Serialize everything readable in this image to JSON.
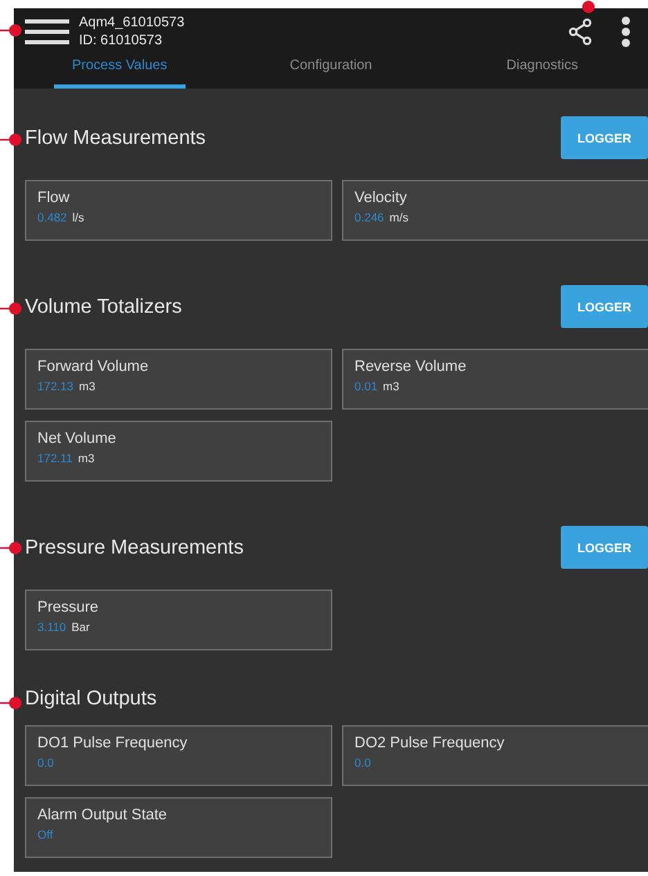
{
  "device": {
    "name": "Aqm4_61010573",
    "id": "ID: 61010573"
  },
  "tabs": [
    {
      "label": "Process Values",
      "selected": true
    },
    {
      "label": "Configuration",
      "selected": false
    },
    {
      "label": "Diagnostics",
      "selected": false
    }
  ],
  "sections": [
    {
      "title": "Flow Measurements",
      "button": "LOGGER",
      "cards": [
        {
          "label": "Flow",
          "value": "0.482",
          "unit": "l/s"
        },
        {
          "label": "Velocity",
          "value": "0.246",
          "unit": "m/s"
        }
      ]
    },
    {
      "title": "Volume Totalizers",
      "button": "LOGGER",
      "cards": [
        {
          "label": "Forward Volume",
          "value": "172.13",
          "unit": "m3"
        },
        {
          "label": "Reverse Volume",
          "value": "0.01",
          "unit": "m3"
        },
        {
          "label": "Net Volume",
          "value": "172.11",
          "unit": "m3"
        }
      ]
    },
    {
      "title": "Pressure Measurements",
      "button": "LOGGER",
      "cards": [
        {
          "label": "Pressure",
          "value": "3.110",
          "unit": "Bar"
        }
      ]
    },
    {
      "title": "Digital Outputs",
      "cards": [
        {
          "label": "DO1 Pulse Frequency",
          "value": "0.0"
        },
        {
          "label": "DO2 Pulse Frequency",
          "value": "0.0"
        },
        {
          "label": "Alarm Output State",
          "value": "Off"
        }
      ]
    }
  ]
}
